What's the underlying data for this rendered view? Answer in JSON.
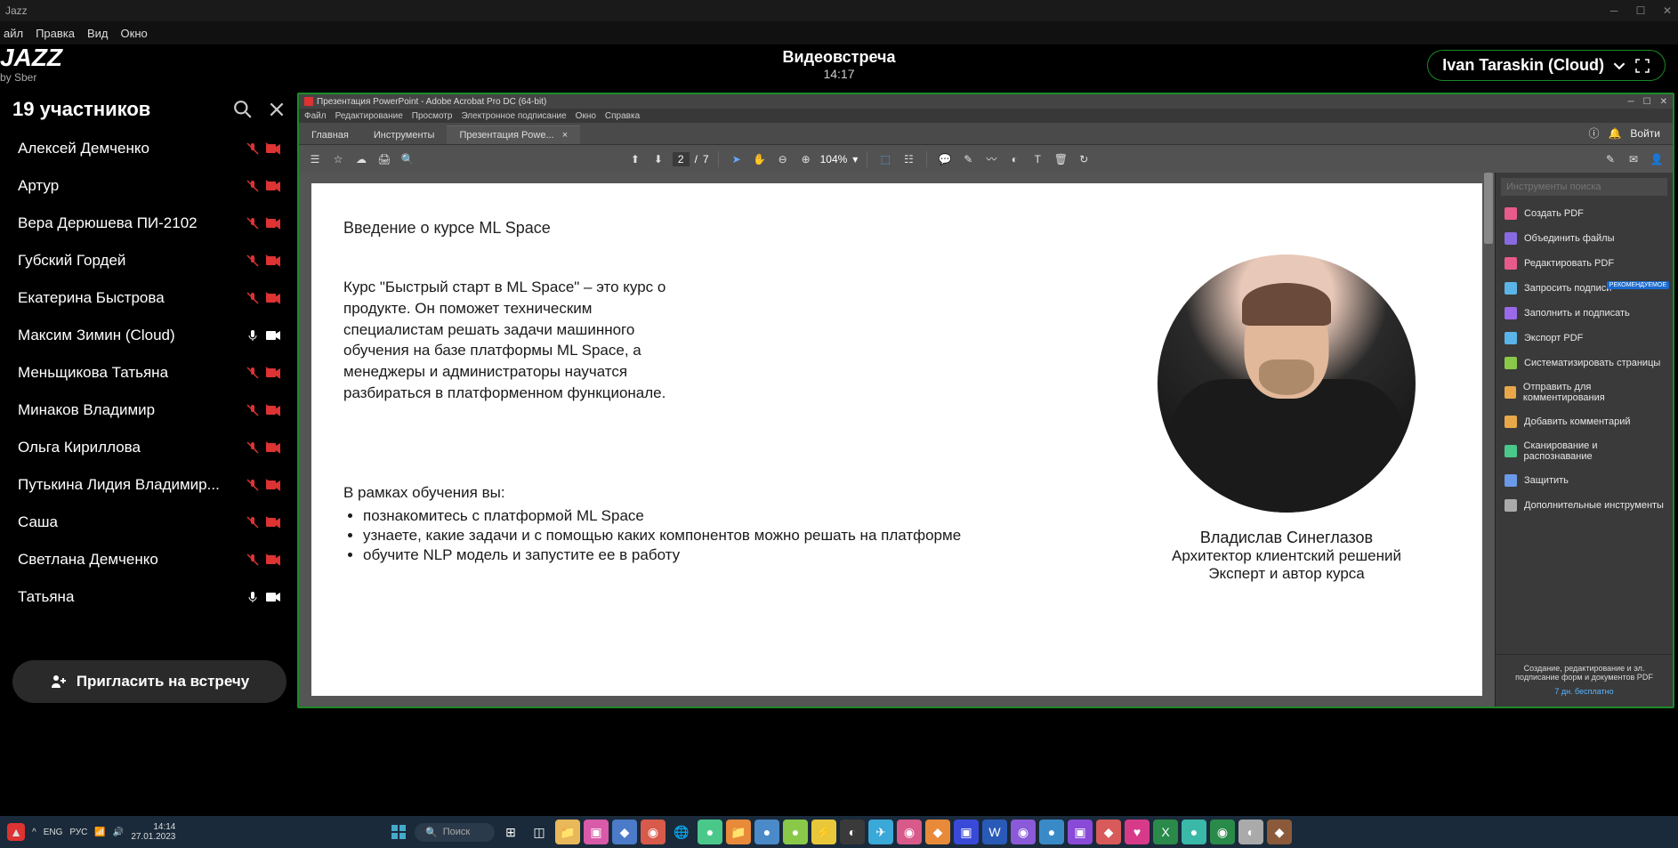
{
  "window": {
    "title": "Jazz"
  },
  "menubar": {
    "items": [
      "айл",
      "Правка",
      "Вид",
      "Окно"
    ]
  },
  "logo": {
    "main": "JAZZ",
    "sub": "by Sber"
  },
  "header": {
    "title": "Видеовстреча",
    "time": "14:17",
    "user": "Ivan Taraskin (Cloud)"
  },
  "participants": {
    "title": "19 участников",
    "list": [
      {
        "name": "Алексей Демченко",
        "mic": "off",
        "cam": "off"
      },
      {
        "name": "Артур",
        "mic": "off",
        "cam": "off"
      },
      {
        "name": "Вера Дерюшева ПИ-2102",
        "mic": "off",
        "cam": "off"
      },
      {
        "name": "Губский Гордей",
        "mic": "off",
        "cam": "off"
      },
      {
        "name": "Екатерина Быстрова",
        "mic": "off",
        "cam": "off"
      },
      {
        "name": "Максим Зимин (Cloud)",
        "mic": "on",
        "cam": "on"
      },
      {
        "name": "Меньщикова Татьяна",
        "mic": "off",
        "cam": "off"
      },
      {
        "name": "Минаков Владимир",
        "mic": "off",
        "cam": "off"
      },
      {
        "name": "Ольга Кириллова",
        "mic": "off",
        "cam": "off"
      },
      {
        "name": "Путькина Лидия Владимир...",
        "mic": "off",
        "cam": "off"
      },
      {
        "name": "Саша",
        "mic": "off",
        "cam": "off"
      },
      {
        "name": "Светлана Демченко",
        "mic": "off",
        "cam": "off"
      },
      {
        "name": "Татьяна",
        "mic": "on",
        "cam": "on"
      }
    ],
    "invite": "Пригласить на встречу"
  },
  "acrobat": {
    "title": "Презентация PowerPoint - Adobe Acrobat Pro DC (64-bit)",
    "menu": [
      "Файл",
      "Редактирование",
      "Просмотр",
      "Электронное подписание",
      "Окно",
      "Справка"
    ],
    "tabs": {
      "home": "Главная",
      "tools": "Инструменты",
      "doc": "Презентация Powe..."
    },
    "login": "Войти",
    "page_current": "2",
    "page_total": "7",
    "zoom": "104%",
    "tools_search_ph": "Инструменты поиска",
    "tools": [
      {
        "label": "Создать PDF",
        "color": "#e85a8a"
      },
      {
        "label": "Объединить файлы",
        "color": "#8a6ae0"
      },
      {
        "label": "Редактировать PDF",
        "color": "#e85a8a"
      },
      {
        "label": "Запросить подписи",
        "color": "#5ab4e8",
        "badge": "РЕКОМЕНДУЕМОЕ"
      },
      {
        "label": "Заполнить и подписать",
        "color": "#9a6ae8"
      },
      {
        "label": "Экспорт PDF",
        "color": "#5ab4e8"
      },
      {
        "label": "Систематизировать страницы",
        "color": "#8ac84a"
      },
      {
        "label": "Отправить для комментирования",
        "color": "#e8a84a"
      },
      {
        "label": "Добавить комментарий",
        "color": "#e8a84a"
      },
      {
        "label": "Сканирование и распознавание",
        "color": "#4ac88a"
      },
      {
        "label": "Защитить",
        "color": "#6a9ae8"
      },
      {
        "label": "Дополнительные инструменты",
        "color": "#aaa"
      }
    ],
    "footer1": "Создание, редактирование и эл. подписание форм и документов PDF",
    "footer2": "7 дн. бесплатно"
  },
  "doc": {
    "h": "Введение о курсе ML Space",
    "p": "Курс \"Быстрый старт в ML Space\" – это курс о продукте. Он поможет техническим специалистам решать задачи машинного обучения на базе платформы ML Space, а менеджеры и администраторы научатся разбираться в платформенном функционале.",
    "h2": "В рамках обучения вы:",
    "li1": "познакомитесь с платформой ML Space",
    "li2": "узнаете, какие задачи и с помощью каких компонентов можно решать на платформе",
    "li3": "обучите NLP модель и запустите ее в работу",
    "pres_name": "Владислав Синеглазов",
    "pres_role": "Архитектор клиентский решений",
    "pres_role2": "Эксперт и автор курса"
  },
  "taskbar": {
    "search": "Поиск",
    "lang": "ENG",
    "kb": "РУС",
    "time": "14:14",
    "date": "27.01.2023"
  }
}
